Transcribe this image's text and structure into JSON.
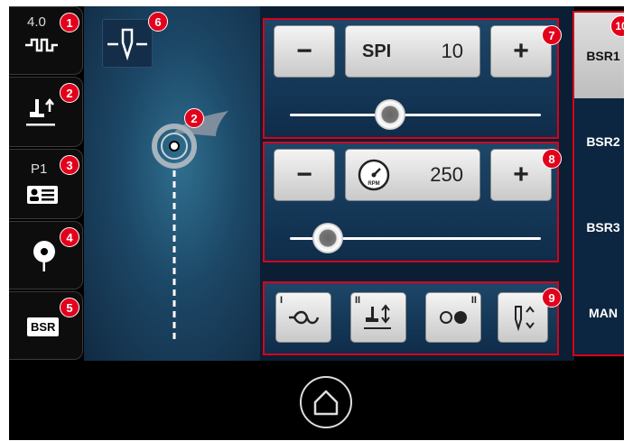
{
  "sidebar": {
    "items": [
      {
        "name": "stitch-length-display",
        "value": "4.0",
        "glyph": "-ΠΠ-",
        "badge": "1"
      },
      {
        "name": "presser-foot-lift",
        "glyph": "┴↑",
        "badge": "2"
      },
      {
        "name": "program-p1",
        "value": "P1",
        "badge": "3"
      },
      {
        "name": "needle-position",
        "badge": "4"
      },
      {
        "name": "bsr-mode",
        "value": "BSR",
        "badge": "5"
      }
    ]
  },
  "canvas": {
    "needle_badge": "6",
    "stitch_badge": "2"
  },
  "spi_group": {
    "minus": "−",
    "label": "SPI",
    "value": "10",
    "plus": "+",
    "badge": "7",
    "slider_level": 0.4
  },
  "speed_group": {
    "minus": "−",
    "value": "250",
    "plus": "+",
    "gauge_text": "RPM",
    "badge": "8",
    "slider_level": 0.15
  },
  "func_group": {
    "badge": "9",
    "buttons": [
      {
        "name": "thread-tie-off-button",
        "mark": "I",
        "glyph": "⚘"
      },
      {
        "name": "foot-lift-button",
        "mark": "II",
        "glyph": "┴⇅"
      },
      {
        "name": "single-double-button",
        "mark": "II",
        "glyph": "○●"
      },
      {
        "name": "needle-up-down-button",
        "mark": "",
        "glyph": "↕"
      }
    ]
  },
  "tabs": {
    "badge": "10",
    "items": [
      "BSR1",
      "BSR2",
      "BSR3",
      "MAN"
    ],
    "active": 0
  },
  "colors": {
    "accent": "#e3001b",
    "panel": "#1d4668"
  }
}
